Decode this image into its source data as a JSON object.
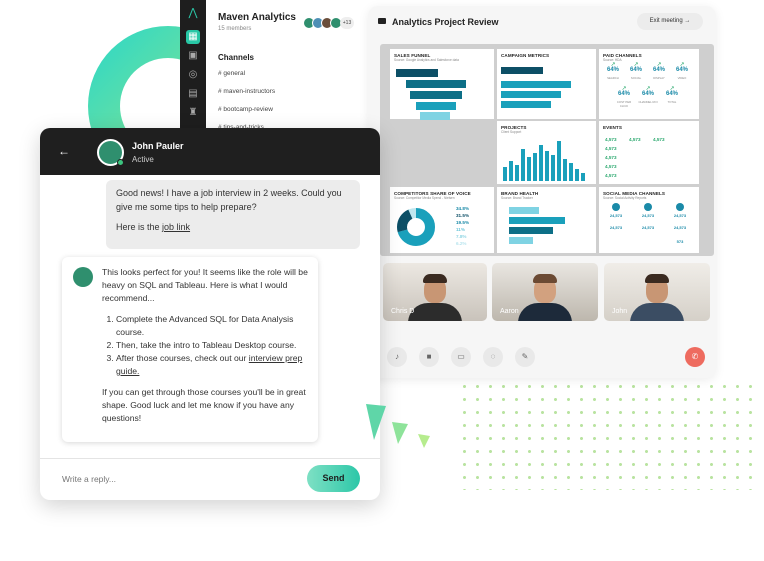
{
  "workspace": {
    "name": "Maven Analytics",
    "members": "15 members",
    "extra_members": "+13",
    "channels_heading": "Channels",
    "channels": [
      "# general",
      "# maven-instructors",
      "# bootcamp-review",
      "# tips-and-tricks"
    ]
  },
  "meeting": {
    "title": "Analytics Project Review",
    "exit_label": "Exit meeting",
    "participants": [
      "Chris D",
      "Aaron",
      "John"
    ]
  },
  "dashboard": {
    "tiles": [
      {
        "title": "SALES FUNNEL",
        "subtitle": "Source: Google Analytics and Salesforce data"
      },
      {
        "title": "CAMPAIGN METRICS",
        "subtitle": ""
      },
      {
        "title": "PAID CHANNELS",
        "subtitle": "Source: HDA"
      },
      {
        "title": "PROJECTS",
        "subtitle": "Client Support"
      },
      {
        "title": "EVENTS",
        "subtitle": ""
      },
      {
        "title": "COMPETITORS SHARE OF VOICE",
        "subtitle": "Source: Competitor Media Spend - Nielsen"
      },
      {
        "title": "BRAND HEALTH",
        "subtitle": "Source: Brand Tracker"
      },
      {
        "title": "SOCIAL MEDIA CHANNELS",
        "subtitle": "Source: Social Activity Reports"
      }
    ],
    "paid_kpis": [
      {
        "value": "64%",
        "label": "SEARCH"
      },
      {
        "value": "64%",
        "label": "SOCIAL"
      },
      {
        "value": "64%",
        "label": "DISPLAY"
      },
      {
        "value": "64%",
        "label": "VIDEO"
      },
      {
        "value": "64%",
        "label": "COST PER CLICK"
      },
      {
        "value": "64%",
        "label": "CHANNEL ROI"
      },
      {
        "value": "64%",
        "label": "TOTAL"
      }
    ],
    "events": [
      "4,573",
      "4,573",
      "4,573",
      "4,573",
      "4,573",
      "4,573",
      "4,573"
    ],
    "share_values": [
      "34.8%",
      "31.5%",
      "19.5%",
      "11%",
      "7.8%",
      "6.2%"
    ],
    "social_values": [
      "24,573",
      "24,573",
      "24,573",
      "24,573",
      "24,573",
      "24,573",
      "573"
    ]
  },
  "chat": {
    "contact_name": "John Pauler",
    "contact_status": "Active",
    "outgoing_line1": "Good news! I have a job interview in 2 weeks. Could you give me some tips to help prepare?",
    "outgoing_line2_prefix": "Here is the ",
    "outgoing_link": "job link",
    "reply_intro": "This looks perfect for you! It seems like the role will be heavy on SQL and Tableau. Here is what I would recommend...",
    "steps": [
      "Complete the Advanced SQL for Data Analysis course.",
      "Then, take the intro to Tableau Desktop course."
    ],
    "step3_prefix": "After those courses, check out our ",
    "step3_link": "interview prep guide.",
    "reply_outro": "If you can get through those courses you'll be in great shape. Good luck and let me know if you have any questions!",
    "reply_placeholder": "Write a reply...",
    "send_label": "Send"
  },
  "icons": {
    "rail": [
      "logo-icon",
      "grid-icon",
      "briefcase-icon",
      "target-icon",
      "document-icon",
      "trophy-icon"
    ],
    "controls": [
      "microphone-icon",
      "camera-icon",
      "screen-share-icon",
      "chat-icon",
      "pen-icon",
      "end-call-icon"
    ]
  },
  "colors": {
    "accent": "#2cc7a8",
    "dark": "#1f1f1f",
    "dashboard_blue": "#1aa0bb",
    "end_call": "#ee6b5f"
  }
}
